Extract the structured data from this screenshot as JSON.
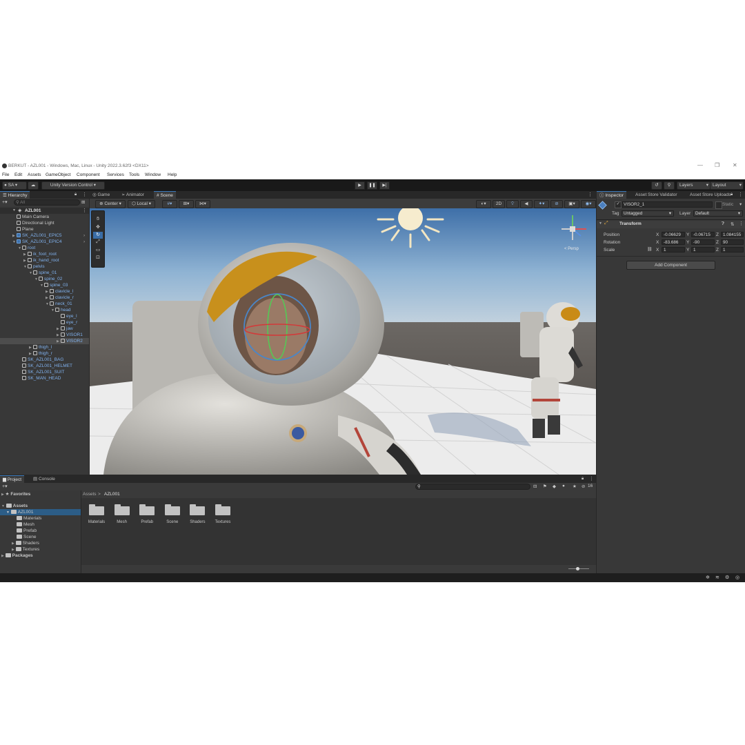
{
  "window": {
    "title": "BERKUT - AZL001 - Windows, Mac, Linux - Unity 2022.3.62f3 <DX11>",
    "controls": [
      "—",
      "❐",
      "✕"
    ]
  },
  "menu": [
    "File",
    "Edit",
    "Assets",
    "GameObject",
    "Component",
    "Services",
    "Tools",
    "Window",
    "Help"
  ],
  "toolbar": {
    "account": "SA",
    "version_control": "Unity Version Control",
    "layers": "Layers",
    "layout": "Layout"
  },
  "hierarchy": {
    "tab": "Hierarchy",
    "search_placeholder": "All",
    "scene": "AZL001",
    "items": [
      {
        "label": "Main Camera",
        "depth": 1,
        "arrow": "",
        "prefab": false
      },
      {
        "label": "Directional Light",
        "depth": 1,
        "arrow": "",
        "prefab": false
      },
      {
        "label": "Plane",
        "depth": 1,
        "arrow": "",
        "prefab": false
      },
      {
        "label": "SK_AZL001_EPIC5",
        "depth": 1,
        "arrow": "▶",
        "prefab": true
      },
      {
        "label": "SK_AZL001_EPIC4",
        "depth": 1,
        "arrow": "▼",
        "prefab": true
      },
      {
        "label": "root",
        "depth": 2,
        "arrow": "▼",
        "prefab": false
      },
      {
        "label": "ik_foot_root",
        "depth": 3,
        "arrow": "▶",
        "prefab": false
      },
      {
        "label": "ik_hand_root",
        "depth": 3,
        "arrow": "▶",
        "prefab": false
      },
      {
        "label": "pelvis",
        "depth": 3,
        "arrow": "▼",
        "prefab": false
      },
      {
        "label": "spine_01",
        "depth": 4,
        "arrow": "▼",
        "prefab": false
      },
      {
        "label": "spine_02",
        "depth": 5,
        "arrow": "▼",
        "prefab": false
      },
      {
        "label": "spine_03",
        "depth": 6,
        "arrow": "▼",
        "prefab": false
      },
      {
        "label": "clavicle_l",
        "depth": 7,
        "arrow": "▶",
        "prefab": false
      },
      {
        "label": "clavicle_r",
        "depth": 7,
        "arrow": "▶",
        "prefab": false
      },
      {
        "label": "neck_01",
        "depth": 7,
        "arrow": "▼",
        "prefab": false
      },
      {
        "label": "head",
        "depth": 8,
        "arrow": "▼",
        "prefab": false
      },
      {
        "label": "eye_l",
        "depth": 9,
        "arrow": "",
        "prefab": false
      },
      {
        "label": "eye_r",
        "depth": 9,
        "arrow": "",
        "prefab": false
      },
      {
        "label": "jaw",
        "depth": 9,
        "arrow": "▶",
        "prefab": false
      },
      {
        "label": "VISOR1",
        "depth": 9,
        "arrow": "▶",
        "prefab": false
      },
      {
        "label": "VISOR2",
        "depth": 9,
        "arrow": "▶",
        "prefab": false,
        "selected": true
      },
      {
        "label": "thigh_l",
        "depth": 4,
        "arrow": "▶",
        "prefab": false
      },
      {
        "label": "thigh_r",
        "depth": 4,
        "arrow": "▶",
        "prefab": false
      },
      {
        "label": "SK_AZL001_BAG",
        "depth": 2,
        "arrow": "",
        "prefab": false
      },
      {
        "label": "SK_AZL001_HELMET",
        "depth": 2,
        "arrow": "",
        "prefab": false
      },
      {
        "label": "SK_AZL001_SUIT",
        "depth": 2,
        "arrow": "",
        "prefab": false
      },
      {
        "label": "SK_MAN_HEAD",
        "depth": 2,
        "arrow": "",
        "prefab": false
      }
    ]
  },
  "scene_view": {
    "tabs": [
      "Game",
      "Animator",
      "Scene"
    ],
    "active_tab": "Scene",
    "pivot": "Center",
    "space": "Local",
    "mode_2d": "2D",
    "projection": "< Persp"
  },
  "inspector": {
    "tabs": [
      "Inspector",
      "Asset Store Validator",
      "Asset Store Uploads"
    ],
    "object_name": "VISOR2_1",
    "static_label": "Static",
    "tag_label": "Tag",
    "tag_value": "Untagged",
    "layer_label": "Layer",
    "layer_value": "Default",
    "component": "Transform",
    "position_label": "Position",
    "rotation_label": "Rotation",
    "scale_label": "Scale",
    "position": {
      "x": "-0.06629",
      "y": "-0.06715",
      "z": "1.084155"
    },
    "rotation": {
      "x": "-83.686",
      "y": "-90",
      "z": "90"
    },
    "scale": {
      "x": "1",
      "y": "1",
      "z": "1"
    },
    "add_component": "Add Component"
  },
  "project": {
    "tabs": [
      "Project",
      "Console"
    ],
    "favorites": "Favorites",
    "assets": "Assets",
    "tree": [
      "AZL001",
      "Materials",
      "Mesh",
      "Prefab",
      "Scene",
      "Shaders",
      "Textures"
    ],
    "packages": "Packages",
    "breadcrumb_root": "Assets",
    "breadcrumb_current": "AZL001",
    "hidden_count": "16",
    "folders": [
      "Materials",
      "Mesh",
      "Prefab",
      "Scene",
      "Shaders",
      "Textures"
    ]
  }
}
